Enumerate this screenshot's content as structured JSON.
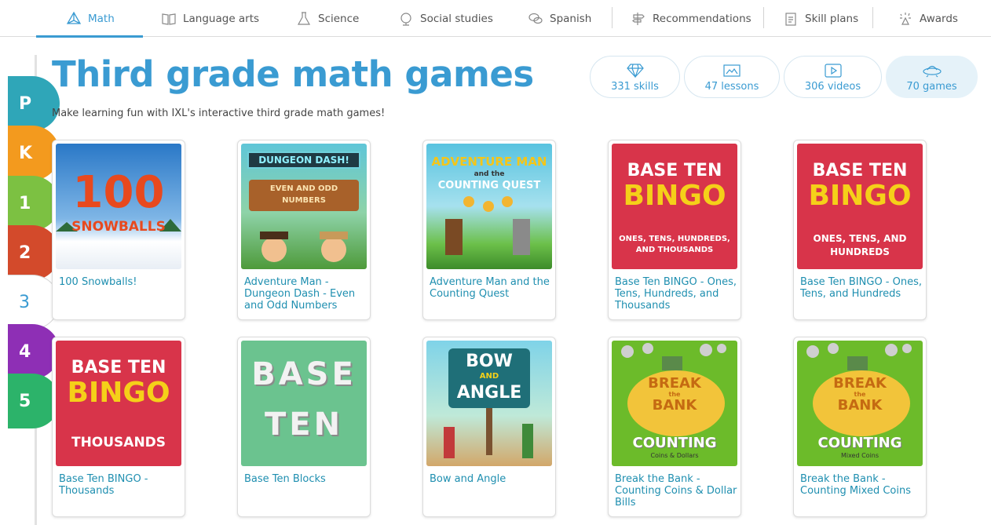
{
  "nav": {
    "items": [
      {
        "label": "Math",
        "icon": "triangle-prism-icon"
      },
      {
        "label": "Language arts",
        "icon": "book-icon"
      },
      {
        "label": "Science",
        "icon": "flask-icon"
      },
      {
        "label": "Social studies",
        "icon": "globe-icon"
      },
      {
        "label": "Spanish",
        "icon": "speech-bubbles-icon"
      },
      {
        "label": "Recommendations",
        "icon": "signpost-icon"
      },
      {
        "label": "Skill plans",
        "icon": "clipboard-icon"
      },
      {
        "label": "Awards",
        "icon": "sparkle-trophy-icon"
      }
    ]
  },
  "grades": [
    {
      "label": "P",
      "color": "#2fa6b8"
    },
    {
      "label": "K",
      "color": "#f39a1e"
    },
    {
      "label": "1",
      "color": "#7cc142"
    },
    {
      "label": "2",
      "color": "#d34a2b"
    },
    {
      "label": "3",
      "color": "#ffffff"
    },
    {
      "label": "4",
      "color": "#8e2fb5"
    },
    {
      "label": "5",
      "color": "#2cb36a"
    }
  ],
  "header": {
    "title": "Third grade math games",
    "subtitle": "Make learning fun with IXL's interactive third grade math games!"
  },
  "stats": [
    {
      "label": "331 skills",
      "icon": "diamond-icon"
    },
    {
      "label": "47 lessons",
      "icon": "lesson-slides-icon"
    },
    {
      "label": "306 videos",
      "icon": "video-icon"
    },
    {
      "label": "70 games",
      "icon": "ufo-icon"
    }
  ],
  "games": [
    {
      "name": "100 Snowballs!",
      "thumb": {
        "line1": "100",
        "line2": "SNOWBALLS"
      }
    },
    {
      "name": "Adventure Man - Dungeon Dash - Even and Odd Numbers",
      "thumb": {
        "line1": "DUNGEON DASH!",
        "line2": "EVEN AND ODD",
        "line3": "NUMBERS"
      }
    },
    {
      "name": "Adventure Man and the Counting Quest",
      "thumb": {
        "line1": "ADVENTURE MAN",
        "line2": "and the",
        "line3": "COUNTING QUEST"
      }
    },
    {
      "name": "Base Ten BINGO - Ones, Tens, Hundreds, and Thousands",
      "thumb": {
        "line1": "BASE TEN",
        "line2": "BINGO",
        "line3": "ONES, TENS, HUNDREDS,",
        "line4": "AND THOUSANDS"
      }
    },
    {
      "name": "Base Ten BINGO - Ones, Tens, and Hundreds",
      "thumb": {
        "line1": "BASE TEN",
        "line2": "BINGO",
        "line3": "ONES, TENS, AND",
        "line4": "HUNDREDS"
      }
    },
    {
      "name": "Base Ten BINGO - Thousands",
      "thumb": {
        "line1": "BASE TEN",
        "line2": "BINGO",
        "line3": "THOUSANDS"
      }
    },
    {
      "name": "Base Ten Blocks",
      "thumb": {
        "line1": "BASE",
        "line2": "TEN"
      }
    },
    {
      "name": "Bow and Angle",
      "thumb": {
        "line1": "BOW",
        "line2": "AND",
        "line3": "ANGLE"
      }
    },
    {
      "name": "Break the Bank - Counting Coins & Dollar Bills",
      "thumb": {
        "line1": "BREAK",
        "line2": "the",
        "line3": "BANK",
        "line4": "COUNTING",
        "line5": "Coins & Dollars"
      }
    },
    {
      "name": "Break the Bank - Counting Mixed Coins",
      "thumb": {
        "line1": "BREAK",
        "line2": "the",
        "line3": "BANK",
        "line4": "COUNTING",
        "line5": "Mixed Coins"
      }
    }
  ]
}
